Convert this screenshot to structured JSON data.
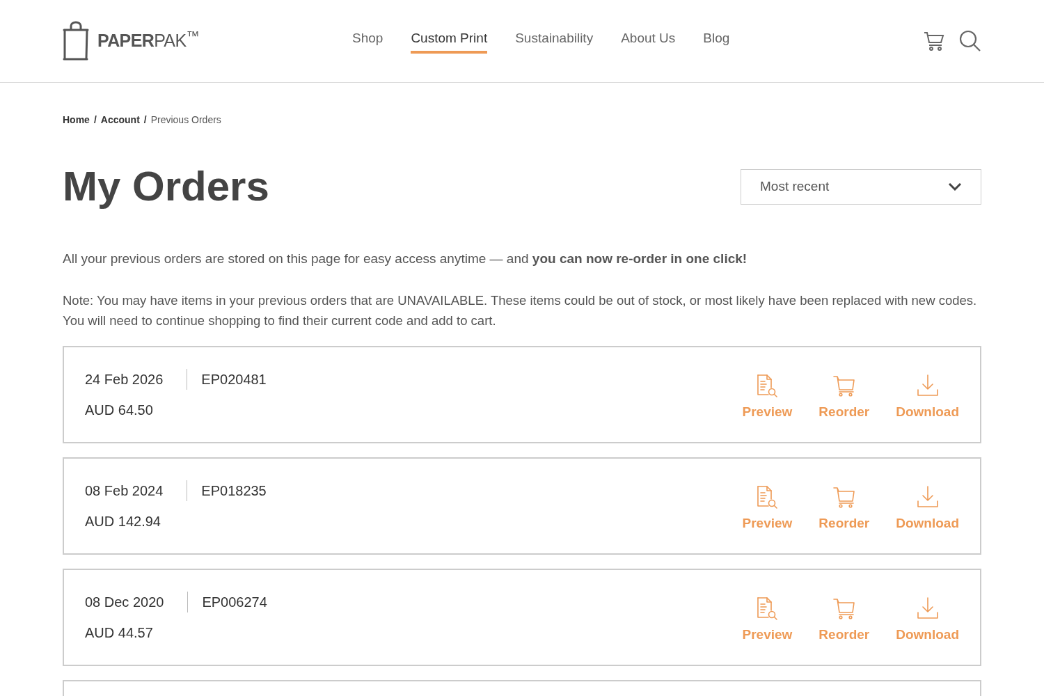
{
  "header": {
    "brand": "**PAPER**PAK$^{™}$",
    "nav": [
      {
        "label": "Shop",
        "selected": false
      },
      {
        "label": "Custom Print",
        "selected": true
      },
      {
        "label": "Sustainability",
        "selected": false
      },
      {
        "label": "About Us",
        "selected": false
      },
      {
        "label": "Blog",
        "selected": false
      }
    ]
  },
  "breadcrumb": [
    {
      "label": "Home",
      "current": false,
      "separator": "/"
    },
    {
      "label": "Account",
      "current": false,
      "separator": "/"
    },
    {
      "label": "Previous Orders",
      "current": true
    }
  ],
  "title": "My Orders",
  "sort": {
    "value": "Most recent"
  },
  "intro": "All your previous orders are stored on this page for easy access anytime — and **you can now re-order in one click!**",
  "note": "Note: You may have items in your previous orders that are UNAVAILABLE. These items could be out of stock, or most likely have been replaced with new codes.  You will need to continue shopping to find their current code and add to cart.",
  "orders": [
    {
      "date": "24 Feb 2026",
      "number": "EP020481",
      "total": "AUD 64.50",
      "actions": [
        {
          "kind": "preview",
          "label": "Preview"
        },
        {
          "kind": "reorder",
          "label": "Reorder"
        },
        {
          "kind": "download",
          "label": "Download"
        }
      ]
    },
    {
      "date": "08 Feb 2024",
      "number": "EP018235",
      "total": "AUD 142.94",
      "actions": [
        {
          "kind": "preview",
          "label": "Preview"
        },
        {
          "kind": "reorder",
          "label": "Reorder"
        },
        {
          "kind": "download",
          "label": "Download"
        }
      ]
    },
    {
      "date": "08 Dec 2020",
      "number": "EP006274",
      "total": "AUD 44.57",
      "actions": [
        {
          "kind": "preview",
          "label": "Preview"
        },
        {
          "kind": "reorder",
          "label": "Reorder"
        },
        {
          "kind": "download",
          "label": "Download"
        }
      ]
    }
  ]
}
